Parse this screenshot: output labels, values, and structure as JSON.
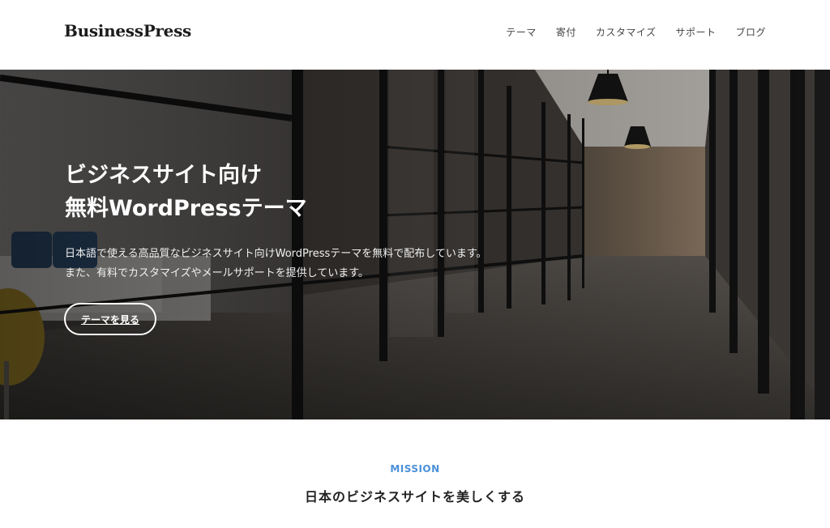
{
  "header": {
    "logo": "BusinessPress",
    "nav": [
      "テーマ",
      "寄付",
      "カスタマイズ",
      "サポート",
      "ブログ"
    ]
  },
  "hero": {
    "title_line1": "ビジネスサイト向け",
    "title_line2": "無料WordPressテーマ",
    "desc_line1": "日本語で使える高品質なビジネスサイト向けWordPressテーマを無料で配布しています。",
    "desc_line2": "また、有料でカスタマイズやメールサポートを提供しています。",
    "button_label": "テーマを見る"
  },
  "mission": {
    "label": "MISSION",
    "title": "日本のビジネスサイトを美しくする"
  },
  "colors": {
    "accent": "#4a90d9",
    "text": "#222222"
  }
}
